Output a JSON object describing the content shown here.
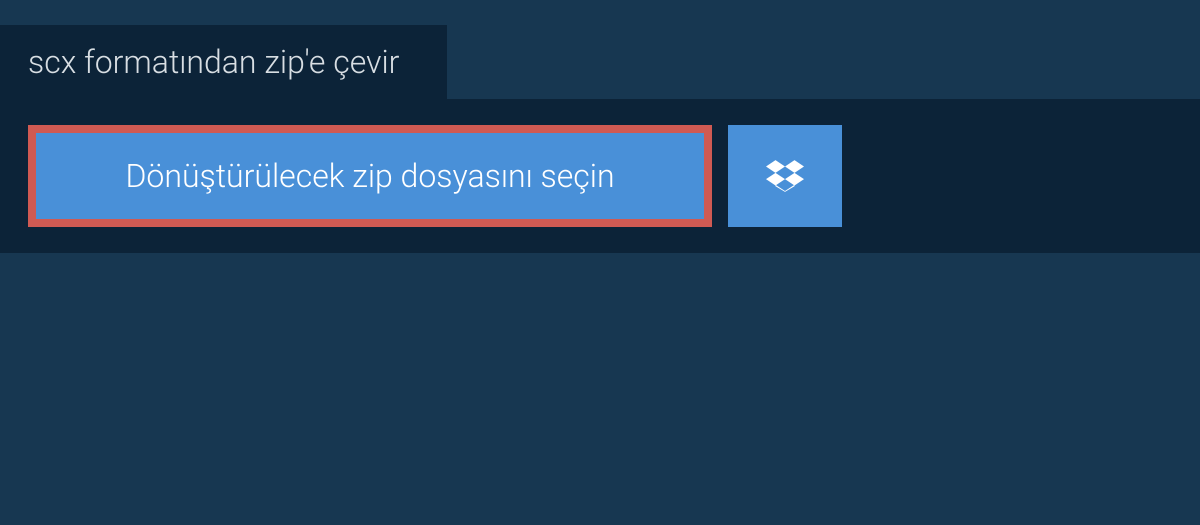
{
  "tab": {
    "label": "scx formatından zip'e çevir"
  },
  "upload": {
    "select_label": "Dönüştürülecek zip dosyasını seçin"
  },
  "colors": {
    "page_background": "#173751",
    "panel_background": "#0c2338",
    "button_background": "#4990d8",
    "button_highlight_border": "#d05a53"
  }
}
